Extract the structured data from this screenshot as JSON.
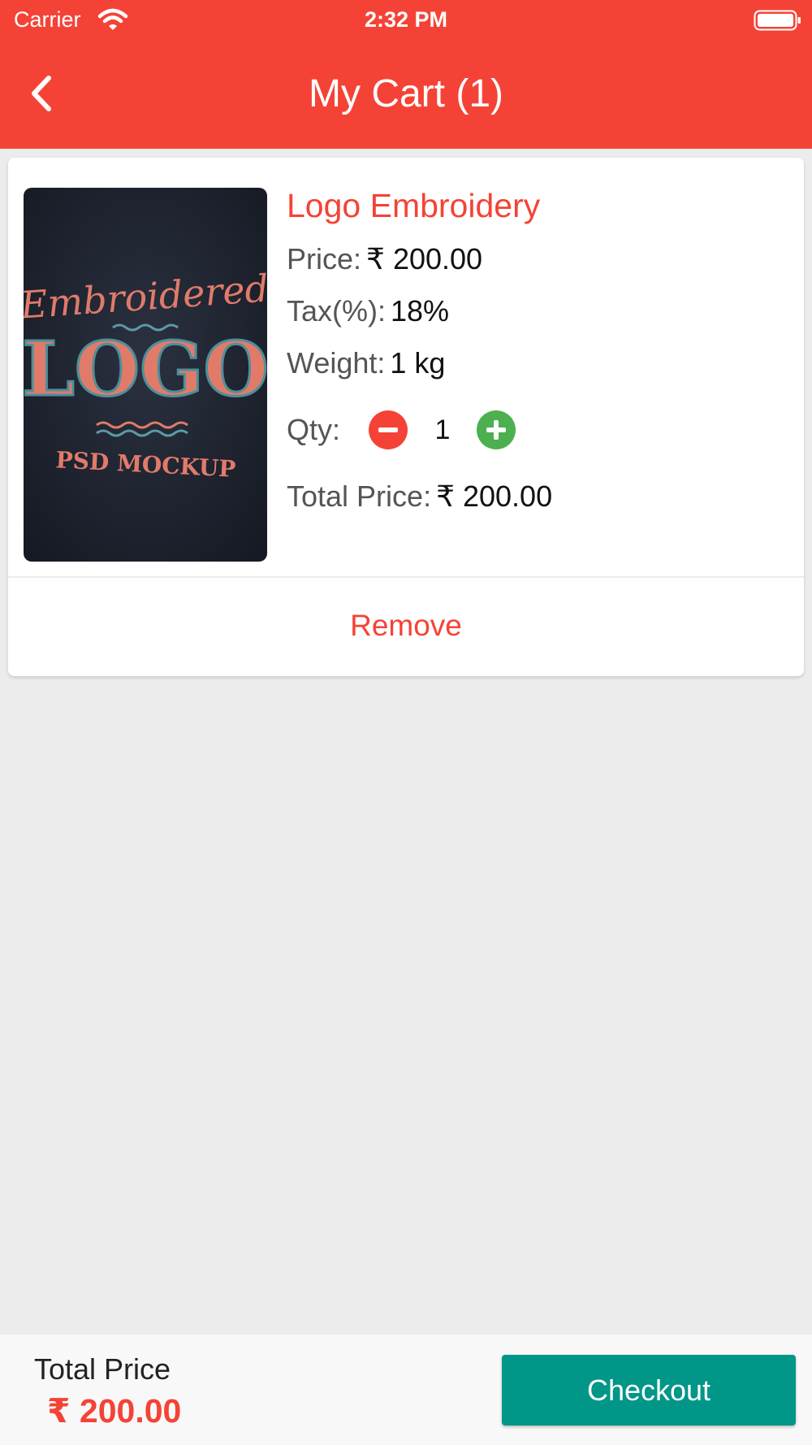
{
  "status_bar": {
    "carrier": "Carrier",
    "time": "2:32 PM",
    "wifi_icon": "wifi-icon",
    "battery_icon": "battery-icon"
  },
  "header": {
    "title": "My Cart (1)",
    "back_icon": "chevron-left-icon",
    "background_color": "#f44336"
  },
  "cart_item": {
    "name": "Logo Embroidery",
    "image_text": {
      "line1": "Embroidered",
      "line2": "LOGO",
      "line3": "PSD MOCKUP"
    },
    "price_label": "Price:",
    "price_value": "₹ 200.00",
    "tax_label": "Tax(%):",
    "tax_value": "18%",
    "weight_label": "Weight:",
    "weight_value": "1 kg",
    "qty_label": "Qty:",
    "qty_value": "1",
    "total_label": "Total Price:",
    "total_value": "₹ 200.00",
    "remove_label": "Remove"
  },
  "footer": {
    "total_label": "Total Price",
    "total_value": "₹ 200.00",
    "checkout_label": "Checkout",
    "checkout_color": "#009688"
  },
  "colors": {
    "accent": "#f44336",
    "minus_button": "#f44336",
    "plus_button": "#4caf50",
    "background": "#ececec"
  }
}
